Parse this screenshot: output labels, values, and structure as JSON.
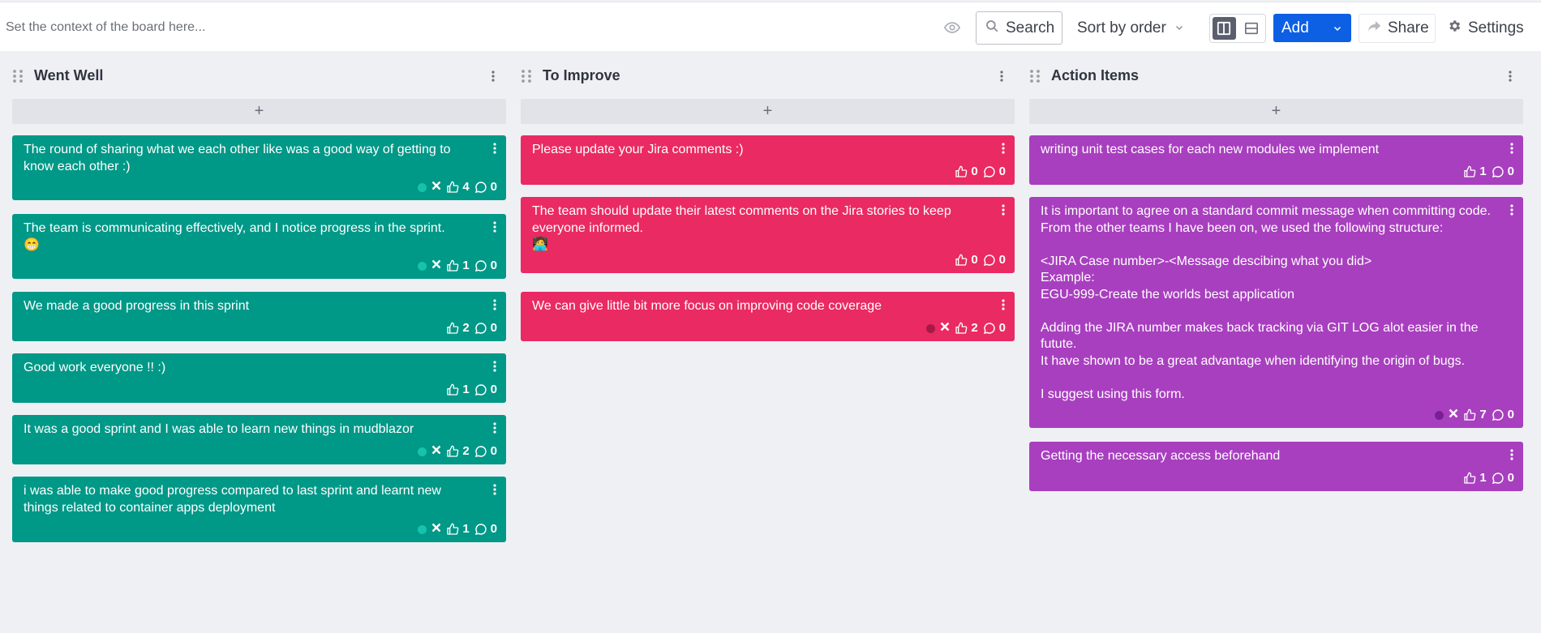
{
  "toolbar": {
    "context_placeholder": "Set the context of the board here...",
    "search_label": "Search",
    "sort_label": "Sort by order",
    "add_label": "Add",
    "share_label": "Share",
    "settings_label": "Settings"
  },
  "colors": {
    "went_well": "#009887",
    "to_improve": "#ea2a62",
    "action_items": "#a83fbf",
    "primary": "#0d5fe3"
  },
  "columns": [
    {
      "title": "Went Well",
      "add_label": "+",
      "cards": [
        {
          "text": "The round of sharing what we each other like was a good way of getting to know each other :)",
          "likes": "4",
          "comments": "0",
          "status": true
        },
        {
          "text": "The team is communicating effectively, and I notice progress in the sprint.\n😁",
          "likes": "1",
          "comments": "0",
          "status": true
        },
        {
          "text": "We made a good progress in this sprint",
          "likes": "2",
          "comments": "0",
          "status": false
        },
        {
          "text": "Good work everyone !! :)",
          "likes": "1",
          "comments": "0",
          "status": false
        },
        {
          "text": "It was a good sprint and I was able to learn new things in mudblazor",
          "likes": "2",
          "comments": "0",
          "status": true
        },
        {
          "text": "i was able to make good progress compared to last sprint and learnt new things related to container apps deployment",
          "likes": "1",
          "comments": "0",
          "status": true
        }
      ]
    },
    {
      "title": "To Improve",
      "add_label": "+",
      "cards": [
        {
          "text": "Please update your Jira comments :)",
          "likes": "0",
          "comments": "0",
          "status": false
        },
        {
          "text": "The team should update their latest comments on the Jira stories to keep everyone informed.\n🧑‍💻",
          "likes": "0",
          "comments": "0",
          "status": false
        },
        {
          "text": "We can give little bit more focus on improving code coverage",
          "likes": "2",
          "comments": "0",
          "status": true
        }
      ]
    },
    {
      "title": "Action Items",
      "add_label": "+",
      "cards": [
        {
          "text": "writing unit test cases for each new modules we implement",
          "likes": "1",
          "comments": "0",
          "status": false
        },
        {
          "text": "It is important to agree on a standard commit message when committing code. From the other teams I have been on, we used the following structure:\n\n<JIRA Case number>-<Message descibing what you did>\nExample:\nEGU-999-Create the worlds best application\n\nAdding the JIRA number makes back tracking via GIT LOG alot easier in the futute.\nIt have shown to be a great advantage when identifying the origin of bugs.\n\nI suggest using this form.",
          "likes": "7",
          "comments": "0",
          "status": true
        },
        {
          "text": "Getting the necessary access beforehand",
          "likes": "1",
          "comments": "0",
          "status": false
        }
      ]
    }
  ]
}
